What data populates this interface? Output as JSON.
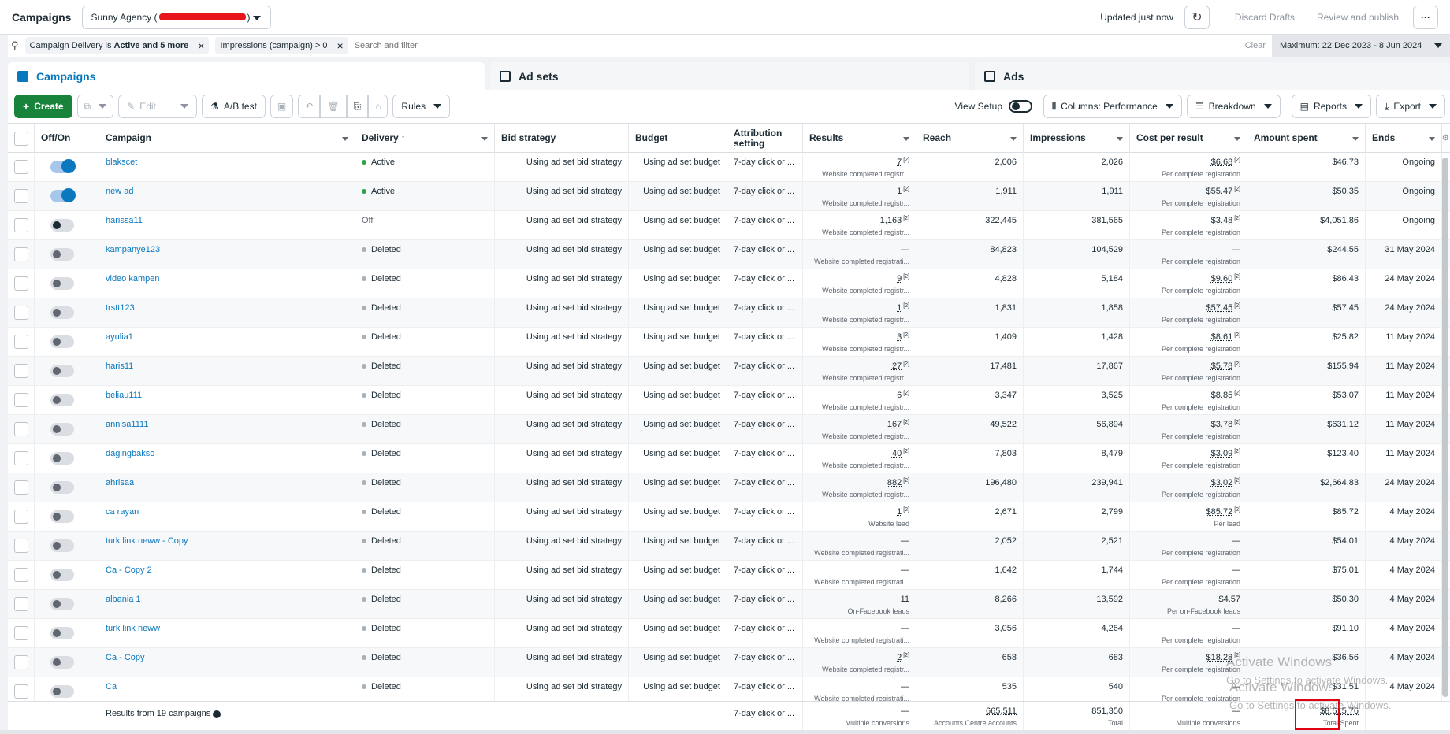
{
  "topbar": {
    "title": "Campaigns",
    "account": "Sunny Agency (",
    "account_end": ")",
    "updated": "Updated just now",
    "discard": "Discard Drafts",
    "review": "Review and publish",
    "more": "···"
  },
  "filters": {
    "chip1": "Campaign Delivery is ",
    "chip1_bold": "Active and 5 more",
    "chip2": "Impressions (campaign) > 0",
    "search_placeholder": "Search and filter",
    "clear": "Clear",
    "date_range": "Maximum: 22 Dec 2023 - 8 Jun 2024"
  },
  "tabs": {
    "campaigns": "Campaigns",
    "adsets": "Ad sets",
    "ads": "Ads"
  },
  "toolbar": {
    "create": "Create",
    "edit": "Edit",
    "ab_test": "A/B test",
    "rules": "Rules",
    "view_setup": "View Setup",
    "columns": "Columns: Performance",
    "breakdown": "Breakdown",
    "reports": "Reports",
    "export": "Export"
  },
  "columns": {
    "offon": "Off/On",
    "campaign": "Campaign",
    "delivery": "Delivery",
    "bid": "Bid strategy",
    "budget": "Budget",
    "attribution": "Attribution setting",
    "results": "Results",
    "reach": "Reach",
    "impressions": "Impressions",
    "cpr": "Cost per result",
    "spent": "Amount spent",
    "ends": "Ends"
  },
  "rows": [
    {
      "name": "blakscet",
      "delivery": "Active",
      "status": "green",
      "toggle": "on",
      "bid": "Using ad set bid strategy",
      "budget": "Using ad set budget",
      "attr": "7-day click or ...",
      "results": "7",
      "results_sub": "Website completed registr...",
      "reach": "2,006",
      "impr": "2,026",
      "cpr": "$6.68",
      "cpr_sub": "Per complete registration",
      "spent": "$46.73",
      "ends": "Ongoing"
    },
    {
      "name": "new ad",
      "delivery": "Active",
      "status": "green",
      "toggle": "on",
      "bid": "Using ad set bid strategy",
      "budget": "Using ad set budget",
      "attr": "7-day click or ...",
      "results": "1",
      "results_sub": "Website completed registr...",
      "reach": "1,911",
      "impr": "1,911",
      "cpr": "$55.47",
      "cpr_sub": "Per complete registration",
      "spent": "$50.35",
      "ends": "Ongoing"
    },
    {
      "name": "harissa11",
      "delivery": "Off",
      "status": "none",
      "toggle": "off-dark",
      "bid": "Using ad set bid strategy",
      "budget": "Using ad set budget",
      "attr": "7-day click or ...",
      "results": "1,163",
      "results_sub": "Website completed registr...",
      "reach": "322,445",
      "impr": "381,565",
      "cpr": "$3.48",
      "cpr_sub": "Per complete registration",
      "spent": "$4,051.86",
      "ends": "Ongoing"
    },
    {
      "name": "kampanye123",
      "delivery": "Deleted",
      "status": "grey",
      "toggle": "off",
      "bid": "Using ad set bid strategy",
      "budget": "Using ad set budget",
      "attr": "7-day click or ...",
      "results": "—",
      "results_sub": "Website completed registrati...",
      "reach": "84,823",
      "impr": "104,529",
      "cpr": "—",
      "cpr_sub": "Per complete registration",
      "spent": "$244.55",
      "ends": "31 May 2024"
    },
    {
      "name": "video kampen",
      "delivery": "Deleted",
      "status": "grey",
      "toggle": "off",
      "bid": "Using ad set bid strategy",
      "budget": "Using ad set budget",
      "attr": "7-day click or ...",
      "results": "9",
      "results_sub": "Website completed registr...",
      "reach": "4,828",
      "impr": "5,184",
      "cpr": "$9.60",
      "cpr_sub": "Per complete registration",
      "spent": "$86.43",
      "ends": "24 May 2024"
    },
    {
      "name": "trstt123",
      "delivery": "Deleted",
      "status": "grey",
      "toggle": "off",
      "bid": "Using ad set bid strategy",
      "budget": "Using ad set budget",
      "attr": "7-day click or ...",
      "results": "1",
      "results_sub": "Website completed registr...",
      "reach": "1,831",
      "impr": "1,858",
      "cpr": "$57.45",
      "cpr_sub": "Per complete registration",
      "spent": "$57.45",
      "ends": "24 May 2024"
    },
    {
      "name": "ayulia1",
      "delivery": "Deleted",
      "status": "grey",
      "toggle": "off",
      "bid": "Using ad set bid strategy",
      "budget": "Using ad set budget",
      "attr": "7-day click or ...",
      "results": "3",
      "results_sub": "Website completed registr...",
      "reach": "1,409",
      "impr": "1,428",
      "cpr": "$8.61",
      "cpr_sub": "Per complete registration",
      "spent": "$25.82",
      "ends": "11 May 2024"
    },
    {
      "name": "haris11",
      "delivery": "Deleted",
      "status": "grey",
      "toggle": "off",
      "bid": "Using ad set bid strategy",
      "budget": "Using ad set budget",
      "attr": "7-day click or ...",
      "results": "27",
      "results_sub": "Website completed registr...",
      "reach": "17,481",
      "impr": "17,867",
      "cpr": "$5.78",
      "cpr_sub": "Per complete registration",
      "spent": "$155.94",
      "ends": "11 May 2024"
    },
    {
      "name": "beliau111",
      "delivery": "Deleted",
      "status": "grey",
      "toggle": "off",
      "bid": "Using ad set bid strategy",
      "budget": "Using ad set budget",
      "attr": "7-day click or ...",
      "results": "6",
      "results_sub": "Website completed registr...",
      "reach": "3,347",
      "impr": "3,525",
      "cpr": "$8.85",
      "cpr_sub": "Per complete registration",
      "spent": "$53.07",
      "ends": "11 May 2024"
    },
    {
      "name": "annisa1111",
      "delivery": "Deleted",
      "status": "grey",
      "toggle": "off",
      "bid": "Using ad set bid strategy",
      "budget": "Using ad set budget",
      "attr": "7-day click or ...",
      "results": "167",
      "results_sub": "Website completed registr...",
      "reach": "49,522",
      "impr": "56,894",
      "cpr": "$3.78",
      "cpr_sub": "Per complete registration",
      "spent": "$631.12",
      "ends": "11 May 2024"
    },
    {
      "name": "dagingbakso",
      "delivery": "Deleted",
      "status": "grey",
      "toggle": "off",
      "bid": "Using ad set bid strategy",
      "budget": "Using ad set budget",
      "attr": "7-day click or ...",
      "results": "40",
      "results_sub": "Website completed registr...",
      "reach": "7,803",
      "impr": "8,479",
      "cpr": "$3.09",
      "cpr_sub": "Per complete registration",
      "spent": "$123.40",
      "ends": "11 May 2024"
    },
    {
      "name": "ahrisaa",
      "delivery": "Deleted",
      "status": "grey",
      "toggle": "off",
      "bid": "Using ad set bid strategy",
      "budget": "Using ad set budget",
      "attr": "7-day click or ...",
      "results": "882",
      "results_sub": "Website completed registr...",
      "reach": "196,480",
      "impr": "239,941",
      "cpr": "$3.02",
      "cpr_sub": "Per complete registration",
      "spent": "$2,664.83",
      "ends": "24 May 2024"
    },
    {
      "name": "ca rayan",
      "delivery": "Deleted",
      "status": "grey",
      "toggle": "off",
      "bid": "Using ad set bid strategy",
      "budget": "Using ad set budget",
      "attr": "7-day click or ...",
      "results": "1",
      "results_sub": "Website lead",
      "reach": "2,671",
      "impr": "2,799",
      "cpr": "$85.72",
      "cpr_sub": "Per lead",
      "spent": "$85.72",
      "ends": "4 May 2024"
    },
    {
      "name": "turk link neww - Copy",
      "delivery": "Deleted",
      "status": "grey",
      "toggle": "off",
      "bid": "Using ad set bid strategy",
      "budget": "Using ad set budget",
      "attr": "7-day click or ...",
      "results": "—",
      "results_sub": "Website completed registrati...",
      "reach": "2,052",
      "impr": "2,521",
      "cpr": "—",
      "cpr_sub": "Per complete registration",
      "spent": "$54.01",
      "ends": "4 May 2024"
    },
    {
      "name": "Ca - Copy 2",
      "delivery": "Deleted",
      "status": "grey",
      "toggle": "off",
      "bid": "Using ad set bid strategy",
      "budget": "Using ad set budget",
      "attr": "7-day click or ...",
      "results": "—",
      "results_sub": "Website completed registrati...",
      "reach": "1,642",
      "impr": "1,744",
      "cpr": "—",
      "cpr_sub": "Per complete registration",
      "spent": "$75.01",
      "ends": "4 May 2024"
    },
    {
      "name": "albania 1",
      "delivery": "Deleted",
      "status": "grey",
      "toggle": "off",
      "bid": "Using ad set bid strategy",
      "budget": "Using ad set budget",
      "attr": "7-day click or ...",
      "results": "11",
      "results_sub": "On-Facebook leads",
      "reach": "8,266",
      "impr": "13,592",
      "cpr": "$4.57",
      "cpr_sub": "Per on-Facebook leads",
      "spent": "$50.30",
      "ends": "4 May 2024"
    },
    {
      "name": "turk link neww",
      "delivery": "Deleted",
      "status": "grey",
      "toggle": "off",
      "bid": "Using ad set bid strategy",
      "budget": "Using ad set budget",
      "attr": "7-day click or ...",
      "results": "—",
      "results_sub": "Website completed registrati...",
      "reach": "3,056",
      "impr": "4,264",
      "cpr": "—",
      "cpr_sub": "Per complete registration",
      "spent": "$91.10",
      "ends": "4 May 2024"
    },
    {
      "name": "Ca - Copy",
      "delivery": "Deleted",
      "status": "grey",
      "toggle": "off",
      "bid": "Using ad set bid strategy",
      "budget": "Using ad set budget",
      "attr": "7-day click or ...",
      "results": "2",
      "results_sub": "Website completed registr...",
      "reach": "658",
      "impr": "683",
      "cpr": "$18.28",
      "cpr_sub": "Per complete registration",
      "spent": "$36.56",
      "ends": "4 May 2024"
    },
    {
      "name": "Ca",
      "delivery": "Deleted",
      "status": "grey",
      "toggle": "off",
      "bid": "Using ad set bid strategy",
      "budget": "Using ad set budget",
      "attr": "7-day click or ...",
      "results": "—",
      "results_sub": "Website completed registrati...",
      "reach": "535",
      "impr": "540",
      "cpr": "—",
      "cpr_sub": "Per complete registration",
      "spent": "$31.51",
      "ends": "4 May 2024"
    }
  ],
  "footer": {
    "label": "Results from 19 campaigns",
    "attr": "7-day click or ...",
    "results": "—",
    "results_sub": "Multiple conversions",
    "reach": "665,511",
    "reach_sub": "Accounts Centre accounts",
    "impr": "851,350",
    "impr_sub": "Total",
    "cpr": "—",
    "cpr_sub": "Multiple conversions",
    "spent": "$8,615.76",
    "spent_sub": "Total Spent"
  },
  "watermark": {
    "line1": "Activate Windows",
    "line2": "Go to Settings to activate Windows."
  }
}
